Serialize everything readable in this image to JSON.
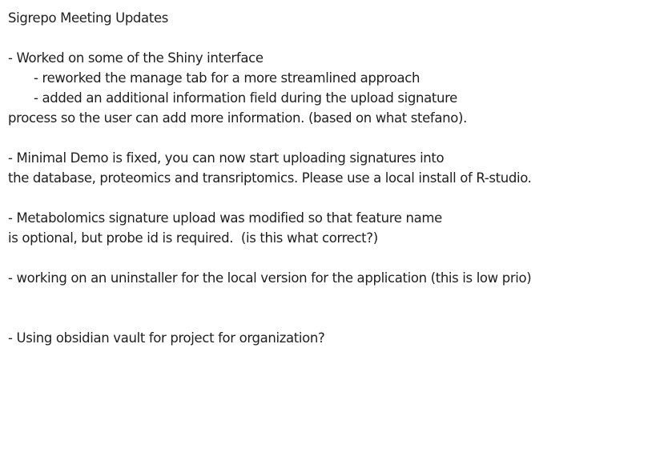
{
  "note": {
    "lines": [
      {
        "text": "Sigrepo Meeting Updates"
      },
      {
        "text": ""
      },
      {
        "text": "- Worked on some of the Shiny interface"
      },
      {
        "text": "- reworked the manage tab for a more streamlined approach",
        "indent": true
      },
      {
        "text": "- added an additional information field during the upload signature",
        "indent": true
      },
      {
        "text": "process so the user can add more information. (based on what stefano)."
      },
      {
        "text": ""
      },
      {
        "text": "- Minimal Demo is fixed, you can now start uploading signatures into"
      },
      {
        "text": "the database, proteomics and transriptomics. Please use a local install of R-studio."
      },
      {
        "text": ""
      },
      {
        "text": "- Metabolomics signature upload was modified so that feature name"
      },
      {
        "text": "is optional, but probe id is required.  (is this what correct?)"
      },
      {
        "text": ""
      },
      {
        "text": "- working on an uninstaller for the local version for the application (this is low prio)"
      },
      {
        "text": ""
      },
      {
        "text": ""
      },
      {
        "text": "- Using obsidian vault for project for organization?"
      }
    ]
  }
}
